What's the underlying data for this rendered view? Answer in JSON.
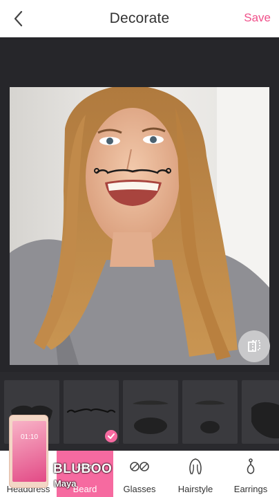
{
  "header": {
    "title": "Decorate",
    "save_label": "Save",
    "back_icon": "chevron-left-icon"
  },
  "colors": {
    "accent": "#f66aa0",
    "save": "#f0508a",
    "background": "#26262a",
    "tile": "#3a3a3e"
  },
  "compare_icon": "compare-icon",
  "sticker_panel": {
    "items": [
      {
        "name": "beard-full",
        "selected": false
      },
      {
        "name": "mustache-curly",
        "selected": true
      },
      {
        "name": "beard-goatee-wide",
        "selected": false
      },
      {
        "name": "beard-goatee-small",
        "selected": false
      },
      {
        "name": "beard-mustache-full",
        "selected": false
      }
    ]
  },
  "tabs": [
    {
      "label": "Headdress",
      "icon": "crown-icon",
      "active": false
    },
    {
      "label": "Beard",
      "icon": "mustache-icon",
      "active": true
    },
    {
      "label": "Glasses",
      "icon": "glasses-icon",
      "active": false
    },
    {
      "label": "Hairstyle",
      "icon": "hairstyle-icon",
      "active": false
    },
    {
      "label": "Earrings",
      "icon": "earring-icon",
      "active": false
    }
  ],
  "watermark": {
    "brand": "BLUBOO",
    "model": "Maya",
    "clock": "01:10"
  }
}
